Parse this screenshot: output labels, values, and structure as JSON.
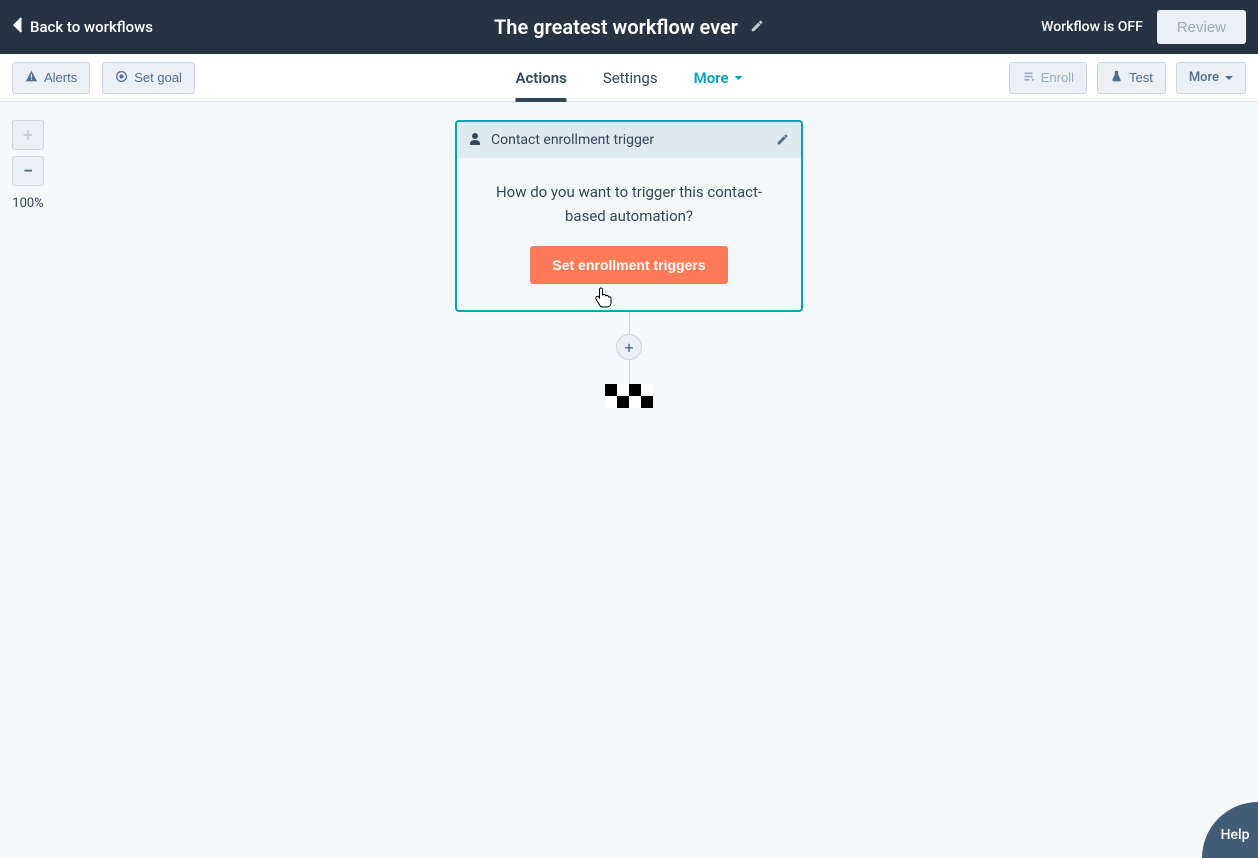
{
  "topbar": {
    "back_label": "Back to workflows",
    "title": "The greatest workflow ever",
    "status_label": "Workflow is OFF",
    "review_label": "Review"
  },
  "toolbar": {
    "alerts_label": "Alerts",
    "set_goal_label": "Set goal",
    "tabs": {
      "actions": "Actions",
      "settings": "Settings",
      "more": "More"
    },
    "enroll_label": "Enroll",
    "test_label": "Test",
    "more_label": "More"
  },
  "zoom": {
    "percent_label": "100%"
  },
  "trigger_card": {
    "header_label": "Contact enrollment trigger",
    "prompt": "How do you want to trigger this contact-based automation?",
    "cta_label": "Set enrollment triggers"
  },
  "help": {
    "label": "Help"
  },
  "colors": {
    "accent_teal": "#00a4bd",
    "accent_orange": "#ff7a59",
    "dark_nav": "#253342",
    "text": "#33475b"
  }
}
